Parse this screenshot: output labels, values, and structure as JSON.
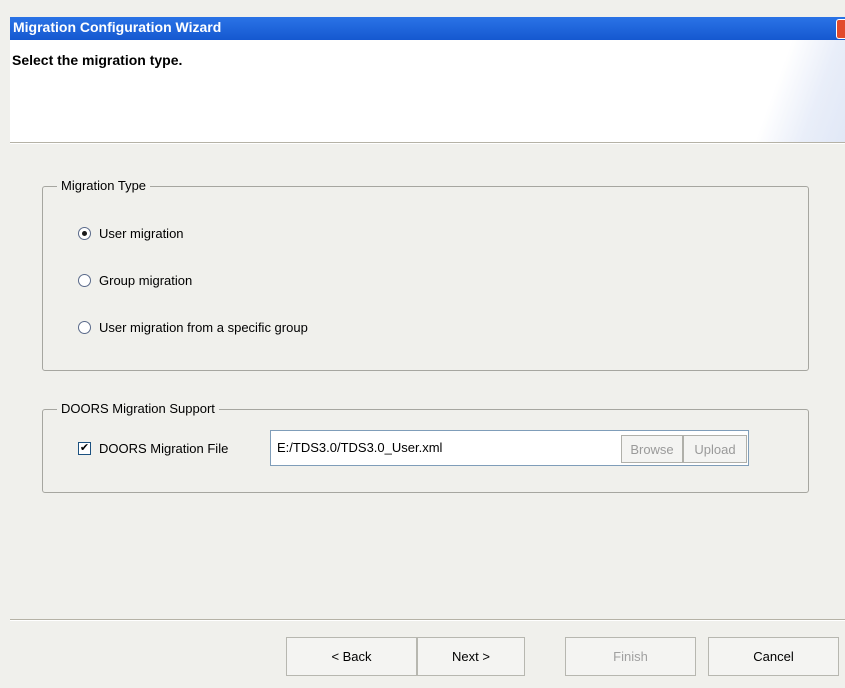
{
  "window": {
    "title": "Migration Configuration Wizard"
  },
  "header": {
    "subtitle": "Select the migration type."
  },
  "migration_type": {
    "legend": "Migration Type",
    "options": [
      {
        "label": "User migration",
        "selected": true
      },
      {
        "label": "Group migration",
        "selected": false
      },
      {
        "label": "User migration from a specific group",
        "selected": false
      }
    ]
  },
  "doors": {
    "legend": "DOORS Migration Support",
    "checkbox_label": "DOORS Migration File",
    "checked": true,
    "file_path": "E:/TDS3.0/TDS3.0_User.xml",
    "browse_label": "Browse",
    "upload_label": "Upload"
  },
  "footer": {
    "back_label": "< Back",
    "next_label": "Next >",
    "finish_label": "Finish",
    "cancel_label": "Cancel"
  },
  "colors": {
    "titlebar": "#1f66dc",
    "close": "#e24a2c"
  }
}
